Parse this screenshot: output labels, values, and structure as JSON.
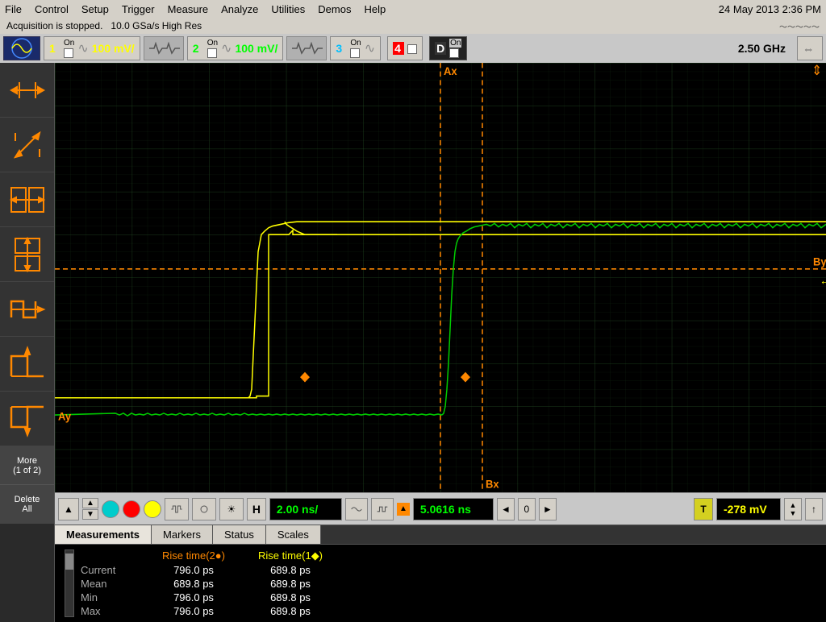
{
  "menubar": {
    "items": [
      "File",
      "Control",
      "Setup",
      "Trigger",
      "Measure",
      "Analyze",
      "Utilities",
      "Demos",
      "Help"
    ],
    "datetime": "24 May 2013  2:36 PM"
  },
  "infobar": {
    "line1": "Acquisition is stopped.",
    "line2": "10.0 GSa/s   High Res"
  },
  "bandwidth": "2.50 GHz",
  "channels": [
    {
      "id": "1",
      "color": "#ffff00",
      "on": "On",
      "value": "100 mV/"
    },
    {
      "id": "2",
      "color": "#00ff00",
      "on": "On",
      "value": "100 mV/"
    },
    {
      "id": "3",
      "color": "#00bfff",
      "on": "On",
      "value": ""
    },
    {
      "id": "4",
      "color": "#ff4444",
      "on": "",
      "value": ""
    },
    {
      "id": "D",
      "color": "#ffffff",
      "on": "On",
      "value": ""
    }
  ],
  "scope": {
    "ax_label": "Ax",
    "bx_label": "Bx",
    "ay_label": "Ay",
    "by_label": "By",
    "t_label": "T"
  },
  "toolbar": {
    "timebase": "2.00 ns/",
    "delay": "5.0616 ns",
    "trigger_level": "-278 mV"
  },
  "tabs": [
    "Measurements",
    "Markers",
    "Status",
    "Scales"
  ],
  "measurements": {
    "col1_header": "Rise time(2●)",
    "col2_header": "Rise time(1◆)",
    "rows": [
      {
        "label": "Current",
        "val1": "796.0 ps",
        "val2": "689.8 ps"
      },
      {
        "label": "Mean",
        "val1": "689.8 ps",
        "val2": "689.8 ps"
      },
      {
        "label": "Min",
        "val1": "796.0 ps",
        "val2": "689.8 ps"
      },
      {
        "label": "Max",
        "val1": "796.0 ps",
        "val2": "689.8 ps"
      }
    ]
  },
  "sidebar_items": [
    {
      "label": "cursor-h-arrows",
      "icon": "↔"
    },
    {
      "label": "cursor-diagonal",
      "icon": "↗"
    },
    {
      "label": "cursor-h-step",
      "icon": "⊢⊣"
    },
    {
      "label": "cursor-v-step",
      "icon": "⊤⊥"
    },
    {
      "label": "waveform-step",
      "icon": "⌐¬"
    },
    {
      "label": "pulse-up",
      "icon": "∏"
    },
    {
      "label": "pulse-down",
      "icon": "∐"
    }
  ],
  "more_label": "More\n(1 of 2)",
  "delete_label": "Delete\nAll"
}
